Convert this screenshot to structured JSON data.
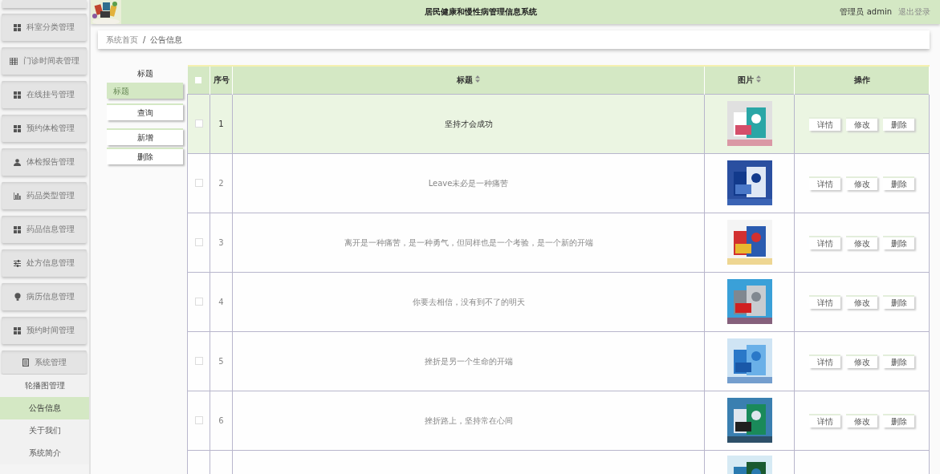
{
  "header": {
    "title": "居民健康和慢性病管理信息系统",
    "user": "管理员 admin",
    "logout": "退出登录"
  },
  "sidebar": {
    "items": [
      {
        "label": "科室分类管理",
        "expanded": false
      },
      {
        "label": "门诊时间表管理",
        "expanded": false
      },
      {
        "label": "在线挂号管理",
        "expanded": false
      },
      {
        "label": "预约体检管理",
        "expanded": false
      },
      {
        "label": "体检报告管理",
        "expanded": false
      },
      {
        "label": "药品类型管理",
        "expanded": false
      },
      {
        "label": "药品信息管理",
        "expanded": false
      },
      {
        "label": "处方信息管理",
        "expanded": false
      },
      {
        "label": "病历信息管理",
        "expanded": false
      },
      {
        "label": "预约时间管理",
        "expanded": false
      },
      {
        "label": "系统管理",
        "expanded": true,
        "children": [
          {
            "label": "轮播图管理",
            "selected": false
          },
          {
            "label": "公告信息",
            "selected": true
          },
          {
            "label": "关于我们",
            "selected": false
          },
          {
            "label": "系统简介",
            "selected": false
          }
        ]
      }
    ]
  },
  "breadcrumb": [
    "系统首页",
    "/",
    "公告信息"
  ],
  "search": {
    "label": "标题",
    "placeholder": "标题",
    "buttons": [
      "查询",
      "新增",
      "删除"
    ]
  },
  "table": {
    "select_all": {
      "checked": false
    },
    "columns": [
      {
        "label": "序号",
        "sortable": false
      },
      {
        "label": "标题",
        "sortable": true
      },
      {
        "label": "图片",
        "sortable": true
      },
      {
        "label": "操作",
        "sortable": false
      }
    ],
    "rows": [
      {
        "no": "1",
        "title": "坚持才会成功",
        "selected": true,
        "checked": false,
        "picture": {
          "kind": "picture"
        },
        "actions": [
          "详情",
          "修改",
          "删除"
        ]
      },
      {
        "no": "2",
        "title": "Leave未必是一种痛苦",
        "selected": false,
        "checked": false,
        "picture": {
          "kind": "picture"
        },
        "actions": [
          "详情",
          "修改",
          "删除"
        ]
      },
      {
        "no": "3",
        "title": "离开是一种痛苦，是一种勇气，但同样也是一个考验，是一个新的开端",
        "selected": false,
        "checked": false,
        "picture": {
          "kind": "picture"
        },
        "actions": [
          "详情",
          "修改",
          "删除"
        ]
      },
      {
        "no": "4",
        "title": "你要去相信，没有到不了的明天",
        "selected": false,
        "checked": false,
        "picture": {
          "kind": "picture"
        },
        "actions": [
          "详情",
          "修改",
          "删除"
        ]
      },
      {
        "no": "5",
        "title": "挫折是另一个生命的开端",
        "selected": false,
        "checked": false,
        "picture": {
          "kind": "picture"
        },
        "actions": [
          "详情",
          "修改",
          "删除"
        ]
      },
      {
        "no": "6",
        "title": "挫折路上，坚持常在心间",
        "selected": false,
        "checked": false,
        "picture": {
          "kind": "picture"
        },
        "actions": [
          "详情",
          "修改",
          "删除"
        ]
      },
      {
        "picture": {
          "kind": "picture"
        }
      }
    ]
  }
}
